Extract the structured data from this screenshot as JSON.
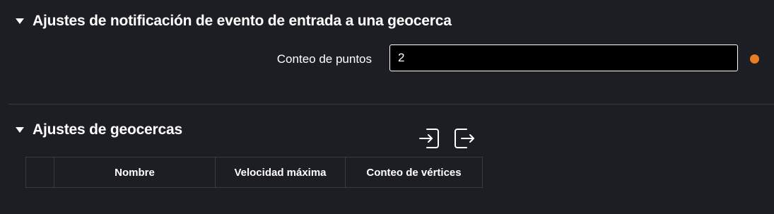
{
  "geofence_entry_notification": {
    "title": "Ajustes de notificación de evento de entrada a una geocerca",
    "point_count_label": "Conteo de puntos",
    "point_count_value": "2"
  },
  "geofence_settings": {
    "title": "Ajustes de geocercas",
    "icons": {
      "import": "import-icon",
      "export": "export-icon"
    },
    "table": {
      "columns": [
        "Nombre",
        "Velocidad máxima",
        "Conteo de vértices"
      ],
      "rows": []
    }
  },
  "colors": {
    "background": "#1d1e23",
    "modified_indicator": "#e87d22",
    "input_background": "#000000",
    "border": "#3a3b41"
  }
}
